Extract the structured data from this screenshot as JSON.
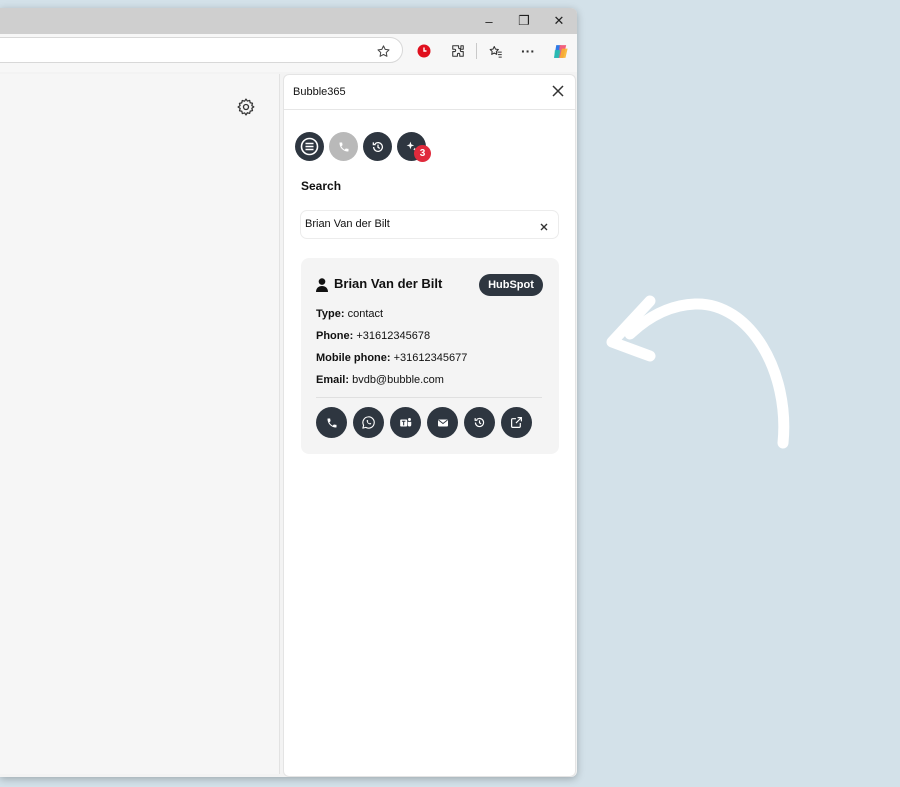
{
  "window": {
    "controls": {
      "minimize": "–",
      "restore": "❐",
      "close": "✕"
    }
  },
  "toolbar": {
    "icons": [
      "star-icon",
      "record-icon",
      "extensions-icon",
      "favorites-icon",
      "more-icon",
      "copilot-icon"
    ],
    "more_label": "···"
  },
  "panel": {
    "title": "Bubble365",
    "nav_buttons": [
      "menu-icon",
      "phone-icon",
      "history-icon",
      "sparkle-icon"
    ],
    "notification_count": "3",
    "search": {
      "label": "Search",
      "value": "Brian Van der Bilt",
      "placeholder": ""
    },
    "result": {
      "name": "Brian Van der Bilt",
      "source": "HubSpot",
      "fields": [
        {
          "label": "Type:",
          "value": "contact"
        },
        {
          "label": "Phone:",
          "value": "+31612345678"
        },
        {
          "label": "Mobile phone:",
          "value": "+31612345677"
        },
        {
          "label": "Email:",
          "value": "bvdb@bubble.com"
        }
      ],
      "actions": [
        "phone-icon",
        "whatsapp-icon",
        "teams-icon",
        "mail-icon",
        "history-icon",
        "external-link-icon"
      ]
    }
  },
  "colors": {
    "page_bg": "#d3e1e9",
    "dark_button": "#2e3640",
    "badge_red": "#e02a3c",
    "card_bg": "#f4f4f4"
  }
}
